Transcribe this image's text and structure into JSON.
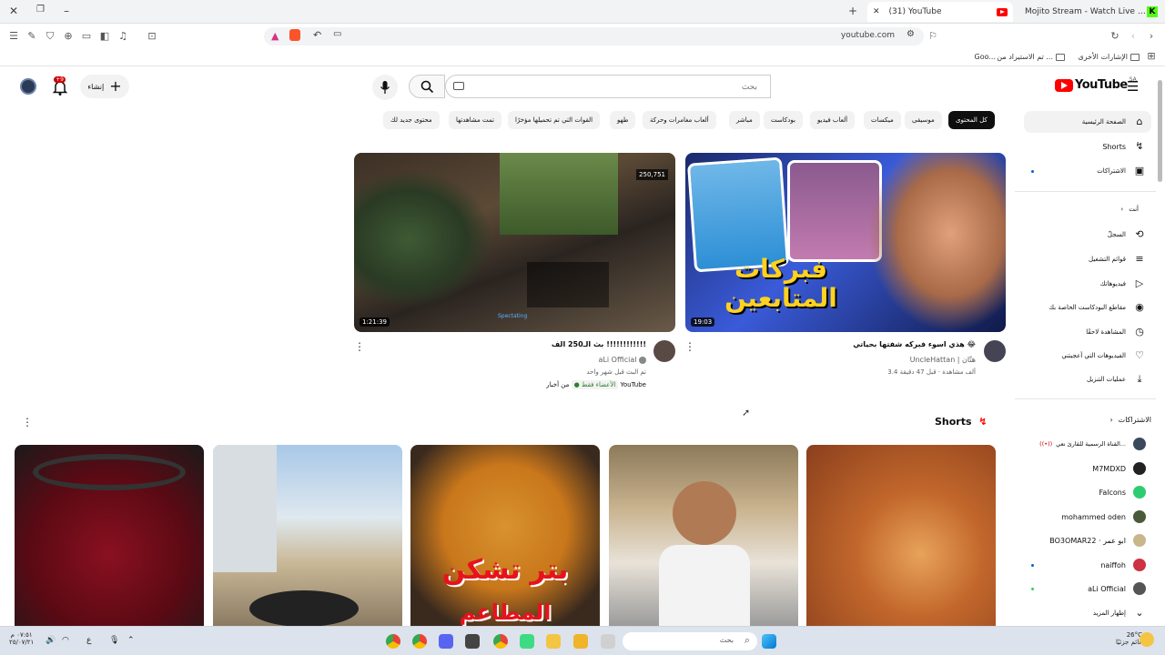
{
  "browser": {
    "tabs": [
      {
        "title": "(31) YouTube",
        "favicon": "youtube-icon"
      },
      {
        "title": "Mojito Stream - Watch Live on Kick",
        "favicon": "kick-icon"
      }
    ],
    "url": "youtube.com",
    "bookmarks": [
      "الإشارات الأخرى",
      "تم الاستيراد من ...",
      "Goo..."
    ]
  },
  "youtube": {
    "logo": "YouTube",
    "country_code": "SA",
    "search_placeholder": "بحث",
    "create_label": "إنشاء",
    "notifications_badge": "+9",
    "chips": [
      "كل المحتوى",
      "موسيقى",
      "ميكسات",
      "ألعاب فيديو",
      "بودكاست",
      "مباشر",
      "ألعاب مغامرات وحركة",
      "طهو",
      "القوات التي تم تحميلها مؤخرًا",
      "تمت مشاهدتها",
      "محتوى جديد لك"
    ],
    "sidebar": {
      "main": [
        {
          "label": "الصفحة الرئيسية",
          "icon": "home-icon"
        },
        {
          "label": "Shorts",
          "icon": "shorts-icon"
        },
        {
          "label": "الاشتراكات",
          "icon": "subscriptions-icon"
        }
      ],
      "you_header": "أنت",
      "you": [
        {
          "label": "السجلّ",
          "icon": "history-icon"
        },
        {
          "label": "قوائم التشغيل",
          "icon": "playlists-icon"
        },
        {
          "label": "فيديوهاتك",
          "icon": "your-videos-icon"
        },
        {
          "label": "مقاطع البودكاست الخاصة بك",
          "icon": "podcast-icon"
        },
        {
          "label": "المشاهدة لاحقًا",
          "icon": "watch-later-icon"
        },
        {
          "label": "الفيديوهات التي أعجبتني",
          "icon": "like-icon"
        },
        {
          "label": "عمليات التنزيل",
          "icon": "download-icon"
        }
      ],
      "subs_header": "الاشتراكات",
      "subscriptions": [
        {
          "name": "القناة الرسمية للقارئ نعي...",
          "color": "#3a4a5c",
          "live": true
        },
        {
          "name": "M7MDXD",
          "color": "#222222"
        },
        {
          "name": "Falcons",
          "color": "#2ecc71"
        },
        {
          "name": "mohammed oden",
          "color": "#4a5a3a"
        },
        {
          "name": "BO3OMAR22 · ابو عمر",
          "color": "#c9b68a"
        },
        {
          "name": "naiffoh",
          "color": "#cc3344",
          "dot": true
        },
        {
          "name": "aLi Official",
          "color": "#555555",
          "dot": true
        }
      ],
      "show_more": "إظهار المزيد"
    },
    "videos": [
      {
        "title": "هذي اسوء فبركه شفتها بحياتي 😂",
        "channel": "UncleHattan | هتّان",
        "meta": "3.4 ألف مشاهدة · قبل 47 دقيقة",
        "duration": "19:03",
        "thumb_text": "فبركات المتابعين"
      },
      {
        "title": "بث الـ250 الف !!!!!!!!!!!!",
        "channel": "aLi Official",
        "meta": "تم البث قبل شهر واحد",
        "badge_source": "من أخبار YouTube",
        "badge_members": "الأعضاء فقط",
        "duration": "1:21:39",
        "counter": "250,751",
        "overlay": "Spectating"
      }
    ],
    "shorts_title": "Shorts",
    "shorts_text": [
      "بتر تشكن",
      "المطاعم"
    ]
  },
  "taskbar": {
    "search_placeholder": "بحث",
    "time": "٠٧:٥١ م",
    "date": "٢٥/٠٧/٢١",
    "temperature": "26°C",
    "weather": "غائم جزئيًا",
    "lang": "ع"
  }
}
